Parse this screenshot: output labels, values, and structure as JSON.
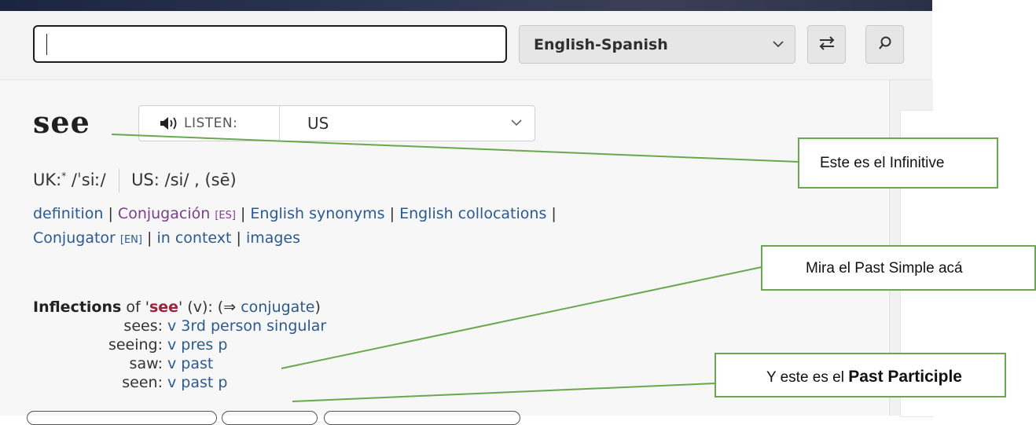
{
  "search": {
    "value": "",
    "language_pair": "English-Spanish",
    "swap_icon": "swap-arrows-icon",
    "search_icon": "search-icon"
  },
  "entry": {
    "headword": "see",
    "listen_label": "LISTEN:",
    "listen_icon": "speaker-icon",
    "accent": "US",
    "pron_uk_label": "UK:",
    "pron_uk_star": "*",
    "pron_uk": "/ˈsiː/",
    "pron_us_label": "US:",
    "pron_us": "/si/ , (sē)"
  },
  "links": {
    "definition": "definition",
    "conjugacion": "Conjugación",
    "conjugacion_tag": "[ES]",
    "synonyms": "English synonyms",
    "collocations": "English collocations",
    "conjugator": "Conjugator",
    "conjugator_tag": "[EN]",
    "in_context": "in context",
    "images": "images"
  },
  "inflections": {
    "title": "Inflections",
    "of": "of '",
    "word": "see",
    "pos": "' (v): (⇒ ",
    "conjugate": "conjugate",
    "close": ")",
    "rows": [
      {
        "form": "sees:",
        "desc": "v 3rd person singular"
      },
      {
        "form": "seeing:",
        "desc": "v pres p"
      },
      {
        "form": "saw:",
        "desc": "v past"
      },
      {
        "form": "seen:",
        "desc": "v past p"
      }
    ]
  },
  "annotations": {
    "infinitive": "Este es el Infinitive",
    "past_simple": "Mira el Past Simple acá",
    "past_participle_prefix": "Y este es el ",
    "past_participle_bold": "Past Participle"
  },
  "colors": {
    "callout_border": "#6aa84f",
    "link": "#2a5a8f",
    "visited_link": "#7a3e8a",
    "headword_highlight": "#a0223a"
  }
}
